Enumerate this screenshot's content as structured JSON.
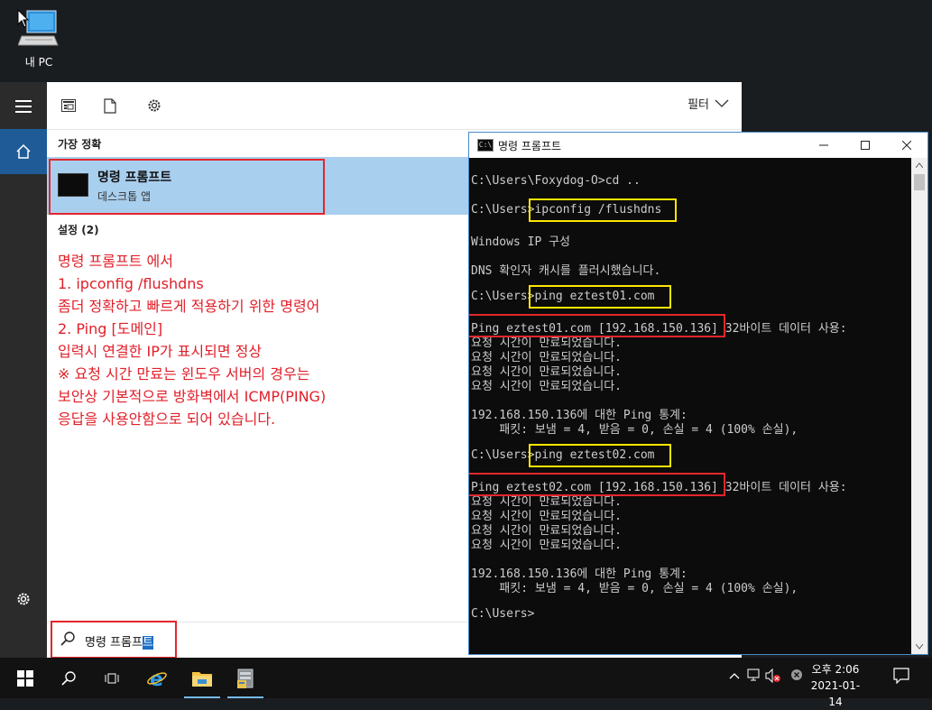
{
  "desktop": {
    "icon_label": "내 PC"
  },
  "toolbar": {
    "filter_label": "필터"
  },
  "search": {
    "section_best_label": "가장 정확",
    "best_result": {
      "title": "명령 프롬프트",
      "subtitle": "데스크톱 앱"
    },
    "section_settings_label": "설정 (2)",
    "query_prefix": "명령 프롬프",
    "query_selected": "트"
  },
  "annotation": {
    "lines": [
      "명령 프롬프트 에서",
      "1. ipconfig /flushdns",
      "좀더 정확하고 빠르게 적용하기 위한 명령어",
      "",
      "2. Ping [도메인]",
      "입력시 연결한 IP가 표시되면 정상",
      "",
      "※ 요청 시간 만료는 윈도우 서버의 경우는",
      "보안상 기본적으로 방화벽에서 ICMP(PING)",
      "응답을 사용안함으로 되어 있습니다."
    ]
  },
  "cmd": {
    "title": "명령 프롬프트",
    "icon_text": "C:\\",
    "lines": [
      "C:\\Users\\Foxydog-O>cd ..",
      "",
      "C:\\Users>ipconfig /flushdns",
      "",
      "Windows IP 구성",
      "",
      "DNS 확인자 캐시를 플러시했습니다.",
      "",
      "C:\\Users>ping eztest01.com",
      "",
      "Ping eztest01.com [192.168.150.136] 32바이트 데이터 사용:",
      "요청 시간이 만료되었습니다.",
      "요청 시간이 만료되었습니다.",
      "요청 시간이 만료되었습니다.",
      "요청 시간이 만료되었습니다.",
      "",
      "192.168.150.136에 대한 Ping 통계:",
      "    패킷: 보냄 = 4, 받음 = 0, 손실 = 4 (100% 손실),",
      "",
      "C:\\Users>ping eztest02.com",
      "",
      "Ping eztest02.com [192.168.150.136] 32바이트 데이터 사용:",
      "요청 시간이 만료되었습니다.",
      "요청 시간이 만료되었습니다.",
      "요청 시간이 만료되었습니다.",
      "요청 시간이 만료되었습니다.",
      "",
      "192.168.150.136에 대한 Ping 통계:",
      "    패킷: 보냄 = 4, 받음 = 0, 손실 = 4 (100% 손실),",
      "",
      "C:\\Users>"
    ]
  },
  "taskbar": {
    "time": "오후 2:06",
    "date": "2021-01-14"
  },
  "colors": {
    "accent": "#1f5c97",
    "highlight_red": "#e3262c",
    "highlight_yellow": "#ffe600",
    "selected_result": "#a9cfee"
  },
  "icons": [
    "pc-icon",
    "hamburger-icon",
    "home-icon",
    "settings-icon",
    "document-icon",
    "app-icon",
    "search-icon",
    "windows-icon",
    "task-view-icon",
    "ie-icon",
    "file-explorer-icon",
    "server-manager-icon",
    "notification-icon"
  ]
}
